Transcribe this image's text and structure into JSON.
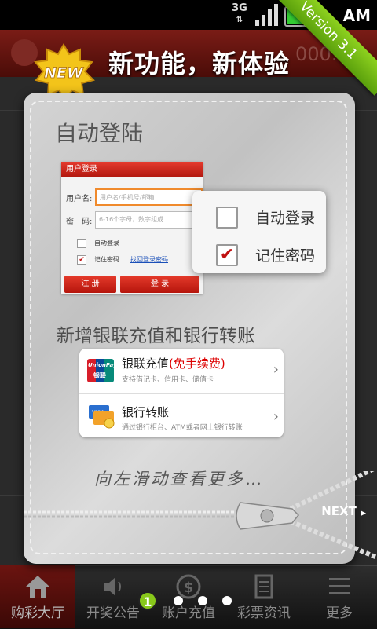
{
  "status_bar": {
    "network": "3G",
    "clock": "AM"
  },
  "background_app": {
    "amount_fragment": "000.00"
  },
  "promo": {
    "new_badge": "NEW",
    "headline": "新功能，新体验",
    "version": "Version 3.1"
  },
  "auto_login": {
    "title": "自动登陆",
    "form": {
      "header": "用户登录",
      "username_label": "用户名:",
      "username_placeholder": "用户名/手机号/邮箱",
      "password_label": "密　码:",
      "password_placeholder": "6-16个字母，数字组成",
      "auto_login_label": "自动登录",
      "remember_label": "记住密码",
      "forgot_link": "找回登录密码",
      "register_button": "注 册",
      "login_button": "登 录"
    },
    "zoom": {
      "auto_login_label": "自动登录",
      "remember_label": "记住密码",
      "remember_checked": true,
      "auto_checked": false
    }
  },
  "payments": {
    "title": "新增银联充值和银行转账",
    "items": [
      {
        "title": "银联充值",
        "title_highlight": "(免手续费)",
        "subtitle": "支持借记卡、信用卡、储值卡",
        "icon": "unionpay-logo"
      },
      {
        "title": "银行转账",
        "subtitle": "通过银行柜台、ATM或者网上银行转账",
        "icon": "bank-cards-icon"
      }
    ]
  },
  "hint": "向左滑动查看更多…",
  "next_label": "NEXT",
  "pager": {
    "current": "1",
    "total_dots": 4
  },
  "tabs": [
    {
      "label": "购彩大厅",
      "icon": "home-icon"
    },
    {
      "label": "开奖公告",
      "icon": "speaker-icon"
    },
    {
      "label": "账户充值",
      "icon": "dollar-icon"
    },
    {
      "label": "彩票资讯",
      "icon": "news-icon"
    },
    {
      "label": "更多",
      "icon": "more-icon"
    }
  ],
  "colors": {
    "accent_red": "#c41a12",
    "version_green": "#7ac41a",
    "pager_green": "#88c81a"
  }
}
